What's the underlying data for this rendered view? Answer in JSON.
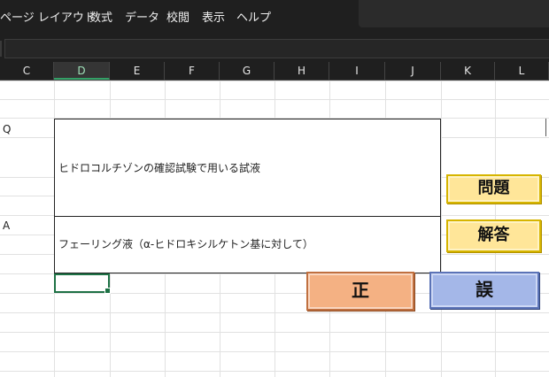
{
  "menu": {
    "items": [
      "ページ レイアウト",
      "数式",
      "データ",
      "校閲",
      "表示",
      "ヘルプ"
    ]
  },
  "columns": [
    "C",
    "D",
    "E",
    "F",
    "G",
    "H",
    "I",
    "J",
    "K",
    "L"
  ],
  "selected_column": "D",
  "row_labels": {
    "q": "Q",
    "a": "A"
  },
  "card": {
    "question": "ヒドロコルチゾンの確認試験で用いる試液",
    "answer": "フェーリング液（α-ヒドロキシルケトン基に対して）"
  },
  "buttons": {
    "question": "問題",
    "answer": "解答",
    "correct": "正",
    "wrong": "誤"
  },
  "colors": {
    "yellow_button": "#ffe699",
    "correct_button": "#f4b183",
    "wrong_button": "#a4b7e8",
    "selection": "#1e7145"
  }
}
